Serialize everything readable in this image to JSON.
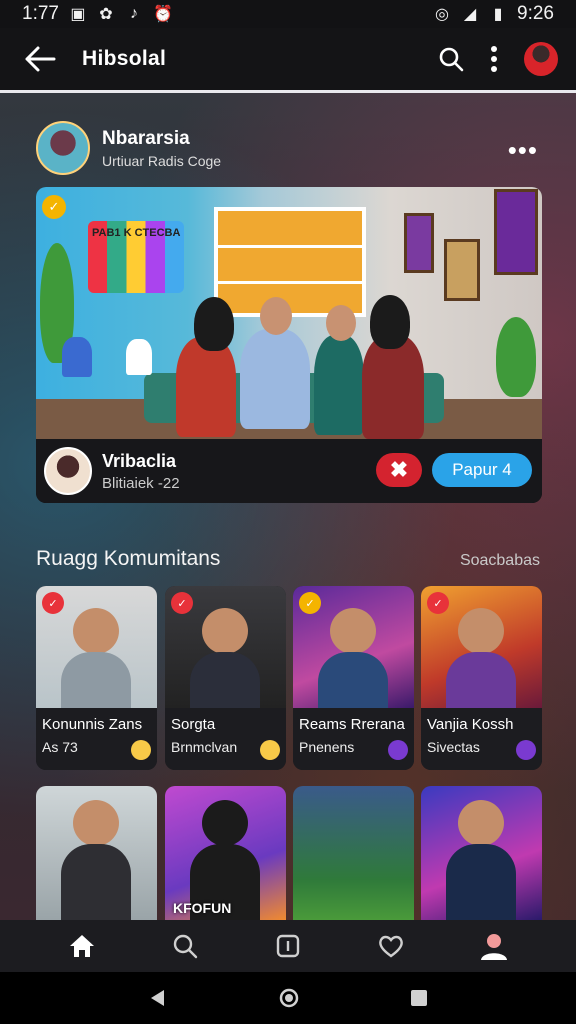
{
  "status_bar": {
    "time": "1:77",
    "clock_right": "9:26"
  },
  "header": {
    "title": "Hibsolal"
  },
  "post": {
    "author": "Nbararsia",
    "subtitle": "Urtiuar Radis Coge",
    "card": {
      "sign_text": "PAB1 K CTECBA",
      "host_name": "Vribaclia",
      "host_sub": "Blitiaiek -22",
      "close_label": "✖",
      "join_label": "Papur 4"
    }
  },
  "section": {
    "title": "Ruagg Komumitans",
    "see_all": "Soacbabas"
  },
  "tiles": [
    {
      "line1": "Konunnis Zans",
      "line2": "As 73"
    },
    {
      "line1": "Sorgta",
      "line2": "Brnmclvan"
    },
    {
      "line1": "Reams Rrerana",
      "line2": "Pnenens"
    },
    {
      "line1": "Vanjia Kossh",
      "line2": "Sivectas"
    }
  ],
  "tiles_row2": [
    {
      "text": ""
    },
    {
      "text": "KFOFUN"
    },
    {
      "text": ""
    },
    {
      "text": ""
    }
  ],
  "colors": {
    "accent_blue": "#2aa3e8",
    "accent_red": "#d4232f"
  },
  "icons": {
    "top": [
      "back-arrow-icon",
      "search-icon",
      "more-vert-icon"
    ],
    "bottom_nav": [
      "home-icon",
      "search-icon",
      "upload-icon",
      "heart-icon",
      "profile-icon"
    ],
    "system": [
      "back-triangle-icon",
      "home-circle-icon",
      "recents-square-icon"
    ]
  }
}
